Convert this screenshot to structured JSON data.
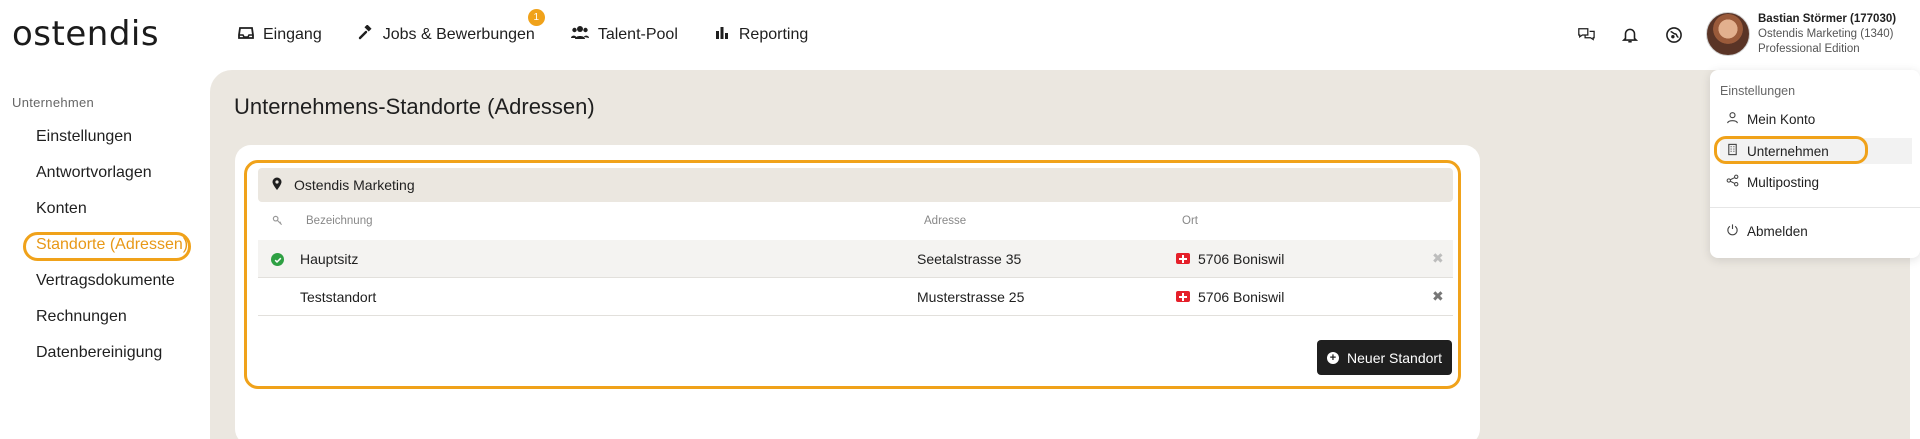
{
  "brand": {
    "logo_text": "ostendis",
    "accent": "#f0a21a"
  },
  "nav": {
    "items": [
      {
        "label": "Eingang",
        "icon": "inbox-icon"
      },
      {
        "label": "Jobs & Bewerbungen",
        "icon": "gavel-icon",
        "badge": "1"
      },
      {
        "label": "Talent-Pool",
        "icon": "users-icon"
      },
      {
        "label": "Reporting",
        "icon": "bar-chart-icon"
      }
    ]
  },
  "top_icons": [
    "chat-icon",
    "bell-icon",
    "globe-icon"
  ],
  "user": {
    "name": "Bastian Störmer (177030)",
    "company": "Ostendis Marketing (1340)",
    "edition": "Professional Edition"
  },
  "sidebar": {
    "heading": "Unternehmen",
    "items": [
      {
        "label": "Einstellungen"
      },
      {
        "label": "Antwortvorlagen"
      },
      {
        "label": "Konten"
      },
      {
        "label": "Standorte (Adressen)",
        "active": true
      },
      {
        "label": "Vertragsdokumente"
      },
      {
        "label": "Rechnungen"
      },
      {
        "label": "Datenbereinigung"
      }
    ]
  },
  "main": {
    "title": "Unternehmens-Standorte (Adressen)",
    "group": "Ostendis Marketing",
    "columns": {
      "designation": "Bezeichnung",
      "address": "Adresse",
      "city": "Ort"
    },
    "rows": [
      {
        "designation": "Hauptsitz",
        "address": "Seetalstrasse 35",
        "city": "5706 Boniswil",
        "primary": true
      },
      {
        "designation": "Teststandort",
        "address": "Musterstrasse 25",
        "city": "5706 Boniswil",
        "primary": false
      }
    ],
    "delete_symbol": "✖",
    "new_button": "Neuer Standort"
  },
  "dropdown": {
    "heading": "Einstellungen",
    "items": [
      {
        "label": "Mein Konto",
        "icon": "user-icon"
      },
      {
        "label": "Unternehmen",
        "icon": "building-icon",
        "active": true
      },
      {
        "label": "Multiposting",
        "icon": "share-icon"
      },
      {
        "label": "Abmelden",
        "icon": "power-icon"
      }
    ]
  }
}
